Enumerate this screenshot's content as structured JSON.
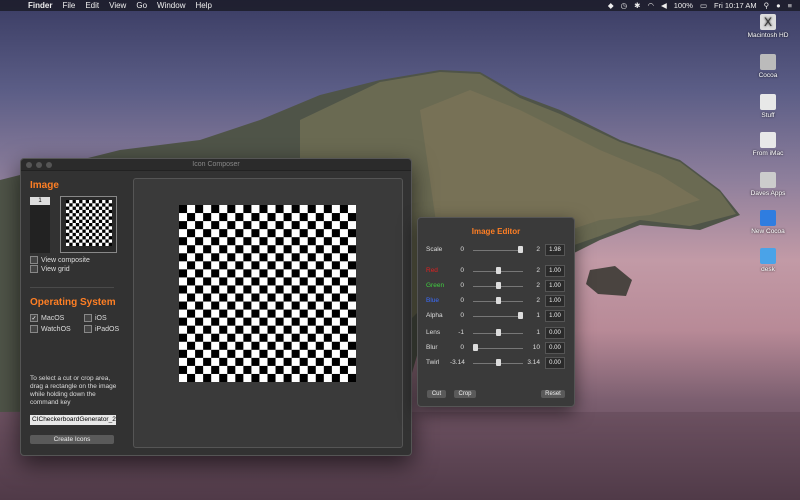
{
  "menubar": {
    "app": "Finder",
    "items": [
      "File",
      "Edit",
      "View",
      "Go",
      "Window",
      "Help"
    ],
    "battery": "100%",
    "clock": "Fri 10:17 AM"
  },
  "desktop_icons": [
    "Macintosh HD",
    "Cocoa",
    "Stuff",
    "From iMac",
    "Daves Apps",
    "New Cocoa",
    "desk"
  ],
  "window": {
    "title": "Icon Composer",
    "image_section": "Image",
    "thumb_number": "1",
    "view_composite": "View composite",
    "view_grid": "View grid",
    "os_section": "Operating System",
    "os_options": [
      {
        "label": "MacOS",
        "checked": true
      },
      {
        "label": "iOS",
        "checked": false
      },
      {
        "label": "WatchOS",
        "checked": false
      },
      {
        "label": "iPadOS",
        "checked": false
      }
    ],
    "hint": "To select a cut or crop area, drag a rectangle on the image while holding down the command key",
    "filename": "CICheckerboardGenerator_2",
    "create_button": "Create Icons"
  },
  "editor": {
    "title": "Image Editor",
    "rows": [
      {
        "label": "Scale",
        "color": "#dddddd",
        "min": "0",
        "max": "2",
        "value": "1.98",
        "fraction": 0.99
      },
      {
        "label": "Red",
        "color": "#e02020",
        "min": "0",
        "max": "2",
        "value": "1.00",
        "fraction": 0.5
      },
      {
        "label": "Green",
        "color": "#40d040",
        "min": "0",
        "max": "2",
        "value": "1.00",
        "fraction": 0.5
      },
      {
        "label": "Blue",
        "color": "#3a6cff",
        "min": "0",
        "max": "2",
        "value": "1.00",
        "fraction": 0.5
      },
      {
        "label": "Alpha",
        "color": "#dddddd",
        "min": "0",
        "max": "1",
        "value": "1.00",
        "fraction": 1.0
      },
      {
        "label": "Lens",
        "color": "#dddddd",
        "min": "-1",
        "max": "1",
        "value": "0.00",
        "fraction": 0.5
      },
      {
        "label": "Blur",
        "color": "#dddddd",
        "min": "0",
        "max": "10",
        "value": "0.00",
        "fraction": 0.0
      },
      {
        "label": "Twirl",
        "color": "#dddddd",
        "min": "-3.14",
        "max": "3.14",
        "value": "0.00",
        "fraction": 0.5
      }
    ],
    "cut_button": "Cut",
    "crop_button": "Crop",
    "reset_button": "Reset"
  }
}
